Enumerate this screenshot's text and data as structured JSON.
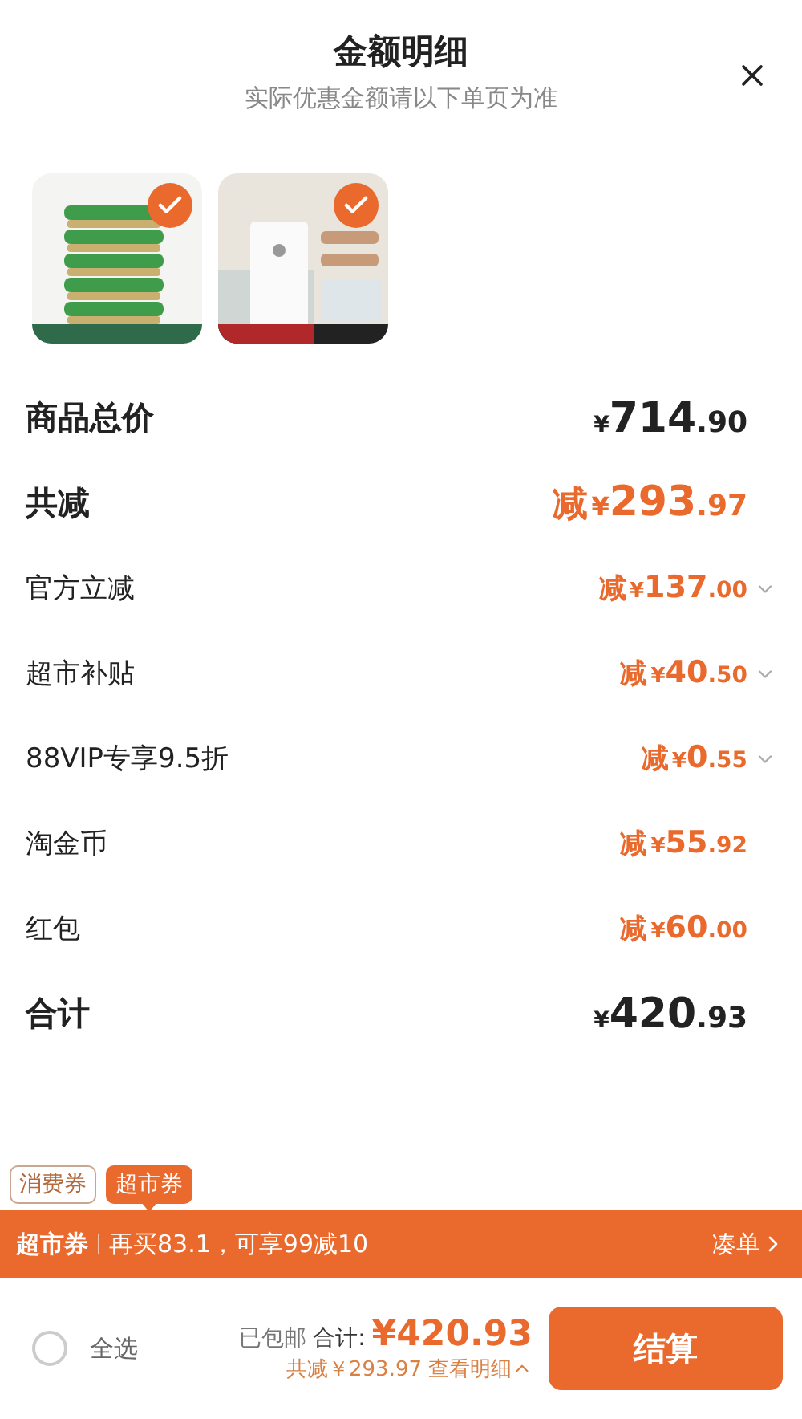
{
  "header": {
    "title": "金额明细",
    "subtitle": "实际优惠金额请以下单页为准"
  },
  "products": [
    {
      "kind": "picture",
      "selected": true
    },
    {
      "kind": "picture",
      "selected": true
    }
  ],
  "rows": [
    {
      "kind": "total",
      "label": "商品总价",
      "prefix": "",
      "currency": "¥",
      "integer": "714",
      "decimal": ".90",
      "expandable": false
    },
    {
      "kind": "reduction-total",
      "label": "共减",
      "prefix": "减",
      "currency": "¥",
      "integer": "293",
      "decimal": ".97",
      "expandable": false
    },
    {
      "kind": "reduction",
      "label": "官方立减",
      "prefix": "减",
      "currency": "¥",
      "integer": "137",
      "decimal": ".00",
      "expandable": true
    },
    {
      "kind": "reduction",
      "label": "超市补贴",
      "prefix": "减",
      "currency": "¥",
      "integer": "40",
      "decimal": ".50",
      "expandable": true
    },
    {
      "kind": "reduction",
      "label": "88VIP专享9.5折",
      "prefix": "减",
      "currency": "¥",
      "integer": "0",
      "decimal": ".55",
      "expandable": true
    },
    {
      "kind": "reduction",
      "label": "淘金币",
      "prefix": "减",
      "currency": "¥",
      "integer": "55",
      "decimal": ".92",
      "expandable": false
    },
    {
      "kind": "reduction",
      "label": "红包",
      "prefix": "减",
      "currency": "¥",
      "integer": "60",
      "decimal": ".00",
      "expandable": false
    },
    {
      "kind": "total",
      "label": "合计",
      "prefix": "",
      "currency": "¥",
      "integer": "420",
      "decimal": ".93",
      "expandable": false
    }
  ],
  "coupon_tabs": [
    {
      "label": "消费券",
      "selected": false
    },
    {
      "label": "超市券",
      "selected": true
    }
  ],
  "banner": {
    "tag": "超市券",
    "message": "再买83.1，可享99减10",
    "link": "凑单"
  },
  "footer": {
    "select_all": {
      "label": "全选",
      "checked": false
    },
    "shipping": "已包邮",
    "total_label": "合计:",
    "total_currency": "¥",
    "total_value": "420.93",
    "savings": "共减￥293.97",
    "details_link": "查看明细",
    "checkout": "结算"
  }
}
